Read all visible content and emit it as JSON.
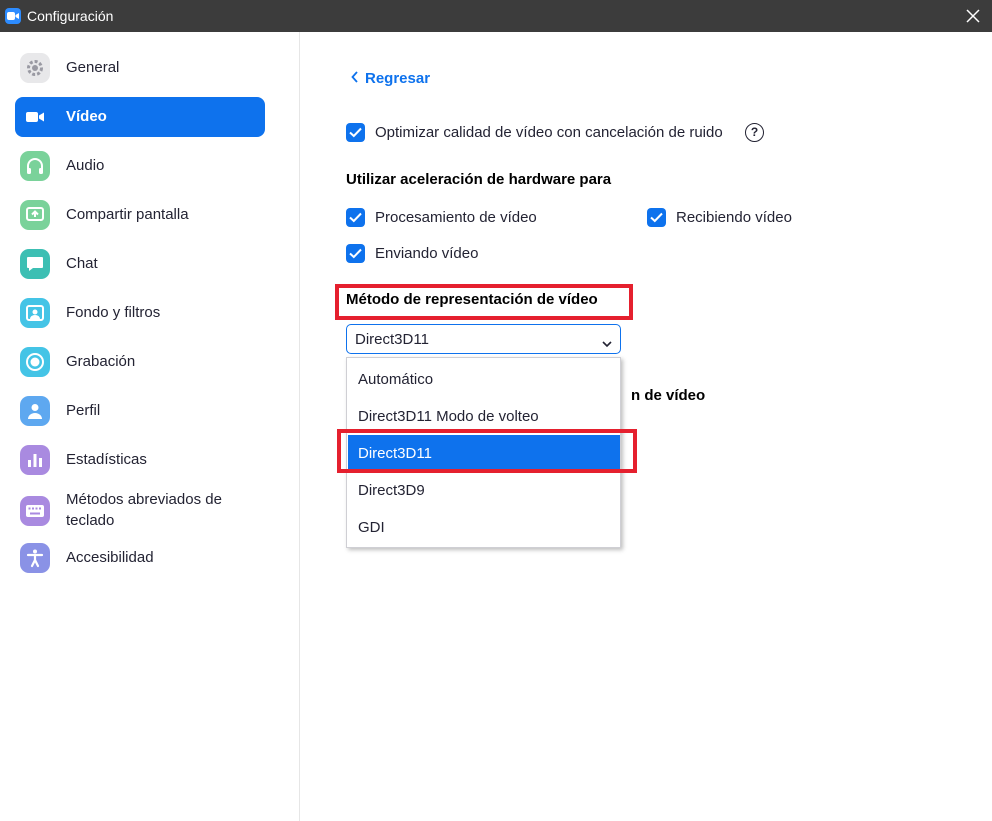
{
  "window": {
    "title": "Configuración",
    "accent_color": "#0e72ed",
    "highlight_color": "#e5202e"
  },
  "sidebar": {
    "items": [
      {
        "label": "General",
        "icon": "gear-icon",
        "color": "#e8e8ea"
      },
      {
        "label": "Vídeo",
        "icon": "video-camera-icon",
        "color": "#0e72ed",
        "active": true
      },
      {
        "label": "Audio",
        "icon": "headphones-icon",
        "color": "#7ad29a"
      },
      {
        "label": "Compartir pantalla",
        "icon": "share-screen-icon",
        "color": "#7ad29a"
      },
      {
        "label": "Chat",
        "icon": "chat-bubble-icon",
        "color": "#3cbfb3"
      },
      {
        "label": "Fondo y filtros",
        "icon": "background-icon",
        "color": "#44c4e6"
      },
      {
        "label": "Grabación",
        "icon": "record-icon",
        "color": "#44c4e6"
      },
      {
        "label": "Perfil",
        "icon": "user-icon",
        "color": "#5ea8f0"
      },
      {
        "label": "Estadísticas",
        "icon": "bar-chart-icon",
        "color": "#a98ae0"
      },
      {
        "label": "Métodos abreviados de teclado",
        "icon": "keyboard-icon",
        "color": "#a98ae0"
      },
      {
        "label": "Accesibilidad",
        "icon": "accessibility-icon",
        "color": "#8a92e6"
      }
    ]
  },
  "content": {
    "back_label": "Regresar",
    "optimize_label": "Optimizar calidad de vídeo con cancelación de ruido",
    "help_glyph": "?",
    "hw_section_title": "Utilizar aceleración de hardware para",
    "hw_options": {
      "processing": "Procesamiento de vídeo",
      "receiving": "Recibiendo vídeo",
      "sending": "Enviando vídeo"
    },
    "render_section_title": "Método de representación de vídeo",
    "render_select_value": "Direct3D11",
    "render_options": [
      "Automático",
      "Direct3D11 Modo de volteo",
      "Direct3D11",
      "Direct3D9",
      "GDI"
    ],
    "partial_hidden_title": "n de vídeo"
  }
}
